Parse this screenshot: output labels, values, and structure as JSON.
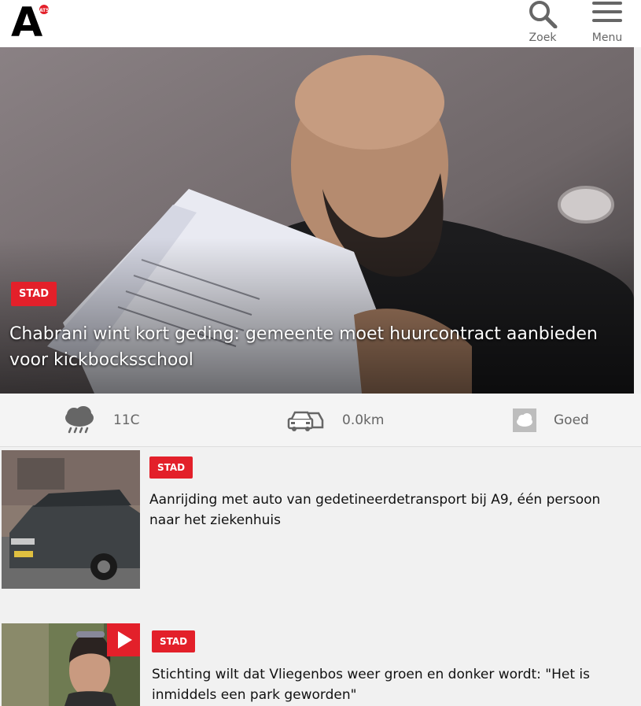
{
  "header": {
    "logo_letter": "A",
    "logo_badge": "AT5",
    "search_label": "Zoek",
    "menu_label": "Menu"
  },
  "hero": {
    "tag": "STAD",
    "title": "Chabrani wint kort geding: gemeente moet huurcontract aanbieden voor kickbocksschool"
  },
  "infobar": {
    "weather_value": "11C",
    "traffic_value": "0.0km",
    "air_value": "Goed",
    "weather_icon": "rain-cloud-icon",
    "traffic_icon": "cars-icon",
    "air_icon": "cloud-icon"
  },
  "articles": [
    {
      "tag": "STAD",
      "title": "Aanrijding met auto van gedetineerdetransport bij A9, één persoon naar het ziekenhuis"
    },
    {
      "tag": "STAD",
      "title": "Stichting wilt dat Vliegenbos weer groen en donker wordt: \"Het is inmiddels een park geworden\""
    }
  ],
  "colors": {
    "accent": "#e3202a",
    "background": "#f1f1f1"
  }
}
